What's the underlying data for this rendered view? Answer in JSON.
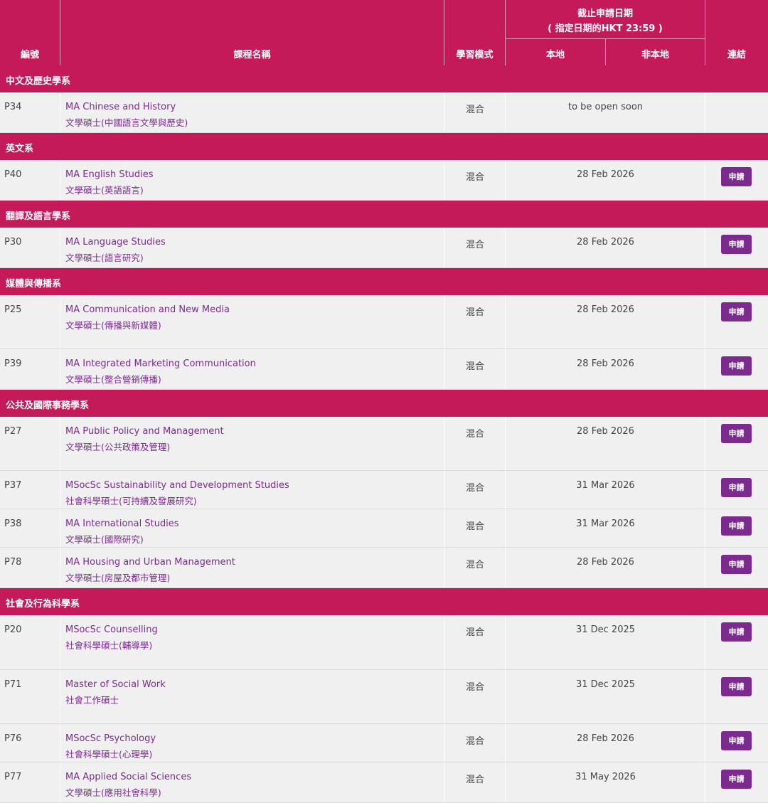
{
  "header": {
    "code": "編號",
    "course_name": "課程名稱",
    "study_mode": "學習模式",
    "deadline_line1": "截止申請日期",
    "deadline_line2": "( 指定日期的HKT 23:59 )",
    "local": "本地",
    "non_local": "非本地",
    "link": "連結"
  },
  "apply_label": "申請",
  "sections": [
    {
      "title": "中文及歷史學系",
      "rows": [
        {
          "code": "P34",
          "en": "MA Chinese and History",
          "zh": "文學碩士(中國語言文學與歷史)",
          "mode": "混合",
          "date": "to be open soon",
          "apply": false
        }
      ]
    },
    {
      "title": "英文系",
      "rows": [
        {
          "code": "P40",
          "en": "MA English Studies",
          "zh": "文學碩士(英語語言)",
          "mode": "混合",
          "date": "28 Feb 2026",
          "apply": true
        }
      ]
    },
    {
      "title": "翻譯及語言學系",
      "rows": [
        {
          "code": "P30",
          "en": "MA Language Studies",
          "zh": "文學碩士(語言研究)",
          "mode": "混合",
          "date": "28 Feb 2026",
          "apply": true
        }
      ]
    },
    {
      "title": "媒體與傳播系",
      "rows": [
        {
          "code": "P25",
          "en": "MA Communication and New Media",
          "zh": "文學碩士(傳播與新媒體)",
          "mode": "混合",
          "date": "28 Feb 2026",
          "apply": true
        },
        {
          "code": "P39",
          "en": "MA Integrated Marketing Communication",
          "zh": "文學碩士(整合營銷傳播)",
          "mode": "混合",
          "date": "28 Feb 2026",
          "apply": true
        }
      ]
    },
    {
      "title": "公共及國際事務學系",
      "rows": [
        {
          "code": "P27",
          "en": "MA Public Policy and Management",
          "zh": "文學碩士(公共政策及管理)",
          "mode": "混合",
          "date": "28 Feb 2026",
          "apply": true
        },
        {
          "code": "P37",
          "en": "MSocSc Sustainability and Development Studies",
          "zh": "社會科學碩士(可持續及發展研究)",
          "mode": "混合",
          "date": "31 Mar 2026",
          "apply": true
        },
        {
          "code": "P38",
          "en": "MA International Studies",
          "zh": "文學碩士(國際研究)",
          "mode": "混合",
          "date": "31 Mar 2026",
          "apply": true
        },
        {
          "code": "P78",
          "en": "MA Housing and Urban Management",
          "zh": "文學碩士(房屋及都市管理)",
          "mode": "混合",
          "date": "28 Feb 2026",
          "apply": true
        }
      ]
    },
    {
      "title": "社會及行為科學系",
      "rows": [
        {
          "code": "P20",
          "en": "MSocSc Counselling",
          "zh": "社會科學碩士(輔導學)",
          "mode": "混合",
          "date": "31 Dec 2025",
          "apply": true
        },
        {
          "code": "P71",
          "en": "Master of Social Work",
          "zh": "社會工作碩士",
          "mode": "混合",
          "date": "31 Dec 2025",
          "apply": true
        },
        {
          "code": "P76",
          "en": "MSocSc Psychology",
          "zh": "社會科學碩士(心理學)",
          "mode": "混合",
          "date": "28 Feb 2026",
          "apply": true
        },
        {
          "code": "P77",
          "en": "MA Applied Social Sciences",
          "zh": "文學碩士(應用社會科學)",
          "mode": "混合",
          "date": "31 May 2026",
          "apply": true
        }
      ]
    }
  ]
}
